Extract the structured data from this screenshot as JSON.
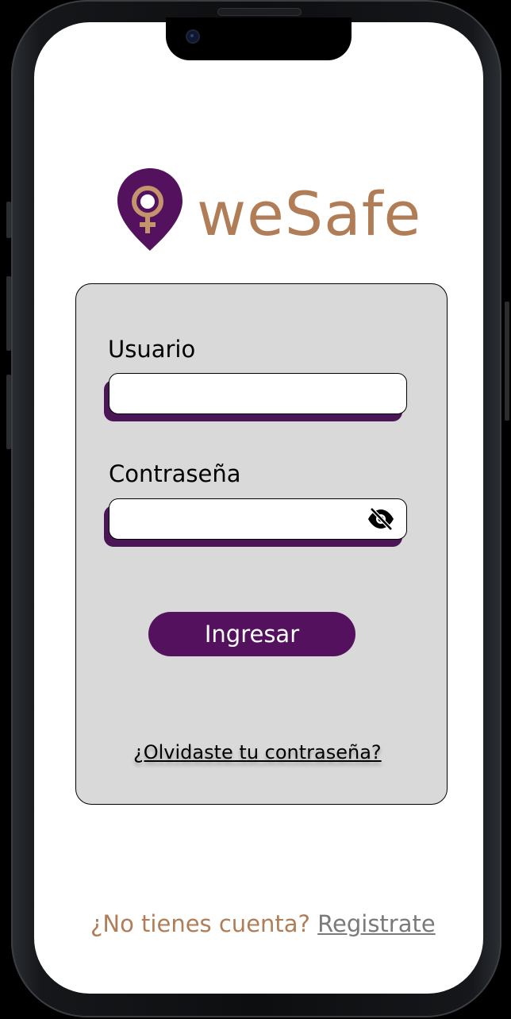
{
  "app": {
    "name": "weSafe"
  },
  "colors": {
    "brand_purple": "#54125e",
    "brand_tan": "#b07d57",
    "card_bg": "#d9d9d9",
    "link_gray": "#7a7a7a"
  },
  "form": {
    "user_label": "Usuario",
    "user_value": "",
    "password_label": "Contraseña",
    "password_value": "",
    "password_toggle_icon": "eye-slash-icon",
    "submit_label": "Ingresar",
    "forgot_label": "¿Olvidaste tu contraseña?"
  },
  "footer": {
    "question": "¿No tienes cuenta?",
    "register_label": "Registrate"
  }
}
